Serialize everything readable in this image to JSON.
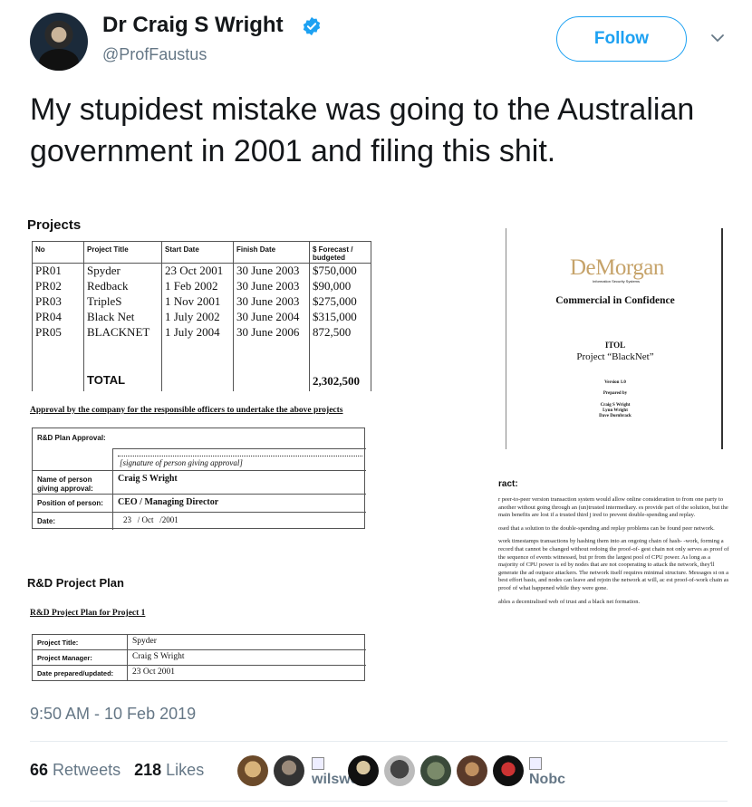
{
  "author": {
    "display_name": "Dr Craig S Wright",
    "handle": "@ProfFaustus",
    "verified": true
  },
  "header": {
    "follow_label": "Follow"
  },
  "tweet": {
    "text": "My stupidest mistake was going to the Australian government in 2001 and filing this shit.",
    "timestamp": "9:50 AM - 10 Feb 2019"
  },
  "document": {
    "projects_heading": "Projects",
    "columns": [
      "No",
      "Project Title",
      "Start Date",
      "Finish Date",
      "$ Forecast / budgeted"
    ],
    "rows": [
      [
        "PR01",
        "Spyder",
        "23 Oct 2001",
        "30 June 2003",
        "$750,000"
      ],
      [
        "PR02",
        "Redback",
        "1 Feb 2002",
        "30 June 2003",
        "$90,000"
      ],
      [
        "PR03",
        "TripleS",
        "1 Nov 2001",
        "30 June 2003",
        "$275,000"
      ],
      [
        "PR04",
        "Black Net",
        "1 July 2002",
        "30 June 2004",
        "$315,000"
      ],
      [
        "PR05",
        "BLACKNET",
        "1 July 2004",
        "30 June 2006",
        "872,500"
      ]
    ],
    "total_label": "TOTAL",
    "total_value": "2,302,500",
    "approval_title": "Approval by the company for the responsible officers to undertake the above projects",
    "approval": {
      "plan_approval_label": "R&D Plan Approval:",
      "signature_placeholder": "[signature of person giving approval]",
      "name_label": "Name of person giving approval:",
      "name_value": "Craig S Wright",
      "position_label": "Position of person:",
      "position_value": "CEO / Managing Director",
      "date_label": "Date:",
      "date_value": "23   / Oct   /2001"
    },
    "rd_heading": "R&D Project Plan",
    "rd_subheading": "R&D Project Plan for Project 1",
    "rd_plan": {
      "title_label": "Project Title:",
      "title_value": "Spyder",
      "manager_label": "Project Manager:",
      "manager_value": "Craig S Wright",
      "date_label": "Date prepared/updated:",
      "date_value": "23 Oct 2001"
    },
    "cover": {
      "brand": "DeMorgan",
      "brand_tagline": "Information Security Systems",
      "confidentiality": "Commercial in Confidence",
      "itol": "ITOL",
      "project": "Project “BlackNet”",
      "version": "Version 1.0",
      "prepared_by": "Prepared by",
      "authors": [
        "Craig S Wright",
        "Lynn Wright",
        "Dave Dornbrack"
      ]
    },
    "abstract_heading": "ract:",
    "abstract_paragraphs": [
      "r peer-to-peer version transaction system would allow online consideration to from one party to another without going through an (un)trusted intermediary. es provide part of the solution, but the main benefits are lost if a trusted third j ired to prevent double-spending and replay.",
      "osed that a solution to the double-spending and replay problems can be found peer network.",
      "work timestamps transactions by hashing them into an ongoing chain of hash- -work, forming a record that cannot be changed without redoing the proof-of- gest chain not only serves as proof of the sequence of events witnessed, but pr from the largest pool of CPU power. As long as a majority of CPU power is ed by nodes that are not cooperating to attack the network, they'll generate the ad outpace attackers. The network itself requires minimal structure. Messages st on a best effort basis, and nodes can leave and rejoin the network at will, ac est proof-of-work chain as proof of what happened while they were gone.",
      "ables a decentralised web of trust and a black net formation."
    ]
  },
  "stats": {
    "retweets_count": "66",
    "retweets_label": "Retweets",
    "likes_count": "218",
    "likes_label": "Likes",
    "liker_alt_1": "wilswe",
    "liker_alt_2": "Nobc"
  },
  "colors": {
    "accent": "#1da1f2",
    "secondary_text": "#657786",
    "brand_gold": "#c6a36a"
  }
}
